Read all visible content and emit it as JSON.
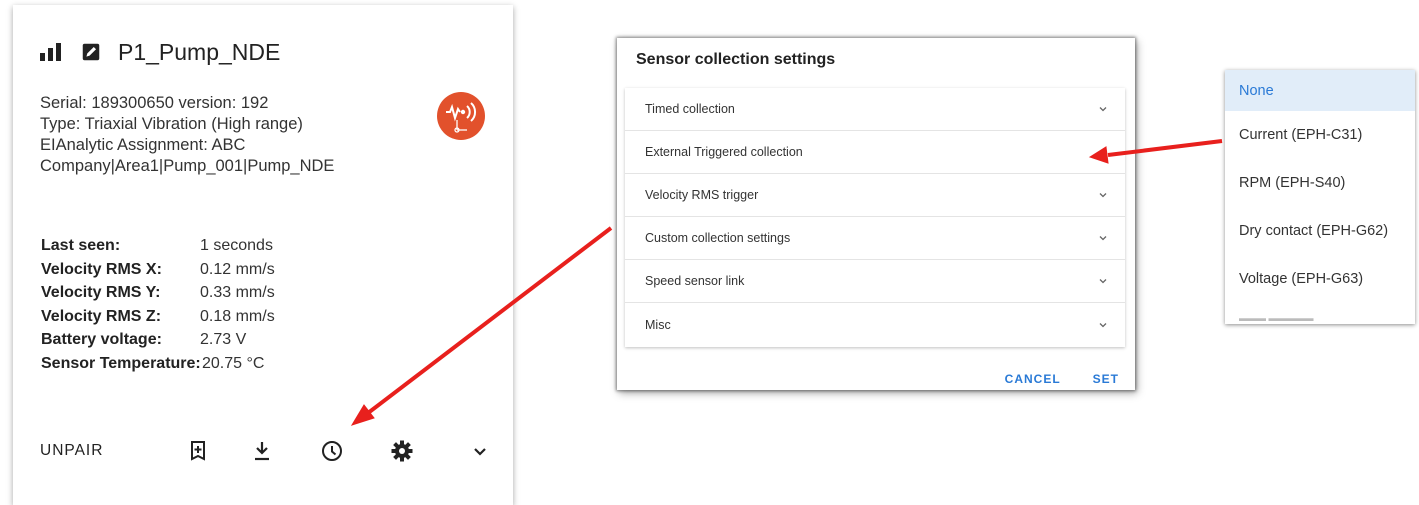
{
  "card": {
    "name": "P1_Pump_NDE",
    "info_lines": [
      "Serial: 189300650 version: 192",
      "Type: Triaxial Vibration (High range)",
      "EIAnalytic Assignment: ABC",
      "Company|Area1|Pump_001|Pump_NDE"
    ],
    "stats": [
      {
        "label": "Last seen:",
        "value": "1 seconds"
      },
      {
        "label": "Velocity RMS X:",
        "value": "0.12 mm/s"
      },
      {
        "label": "Velocity RMS Y:",
        "value": "0.33 mm/s"
      },
      {
        "label": "Velocity RMS Z:",
        "value": "0.18 mm/s"
      },
      {
        "label": "Battery voltage:",
        "value": "2.73 V"
      },
      {
        "label": "Sensor Temperature:",
        "value": "20.75 °C"
      }
    ],
    "unpair_label": "UNPAIR",
    "badge_color": "#e2512c",
    "icons": [
      "signal-icon",
      "edit-icon",
      "vibration-sensor-icon",
      "bookmark-add-icon",
      "download-icon",
      "clock-icon",
      "gear-icon",
      "chevron-down-icon"
    ]
  },
  "dialog": {
    "title": "Sensor collection settings",
    "sections": [
      "Timed collection",
      "External Triggered collection",
      "Velocity RMS trigger",
      "Custom collection settings",
      "Speed sensor link",
      "Misc"
    ],
    "cancel_label": "CANCEL",
    "set_label": "SET",
    "accent_color": "#2a7ad6"
  },
  "dropdown": {
    "selected": "None",
    "options": [
      "None",
      "Current (EPH-C31)",
      "RPM (EPH-S40)",
      "Dry contact (EPH-G62)",
      "Voltage (EPH-G63)"
    ]
  },
  "annotation": {
    "arrow_color": "#e8201d"
  }
}
